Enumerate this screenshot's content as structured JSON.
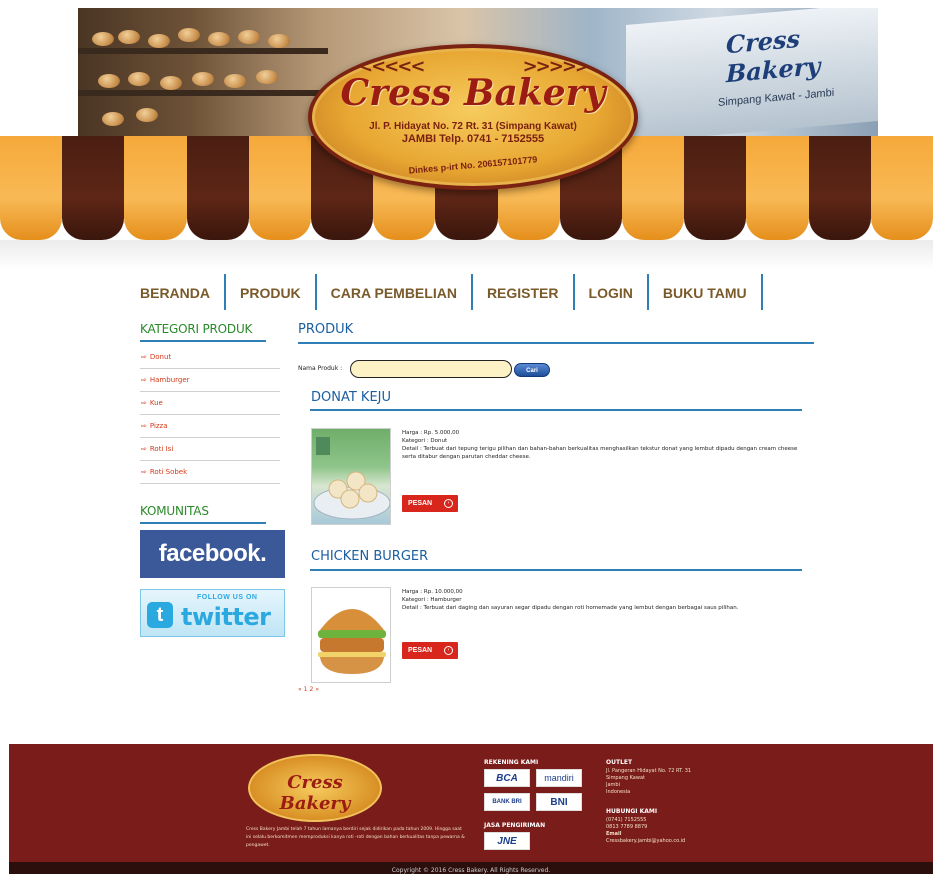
{
  "banner": {
    "logo_name": "Cress Bakery",
    "logo_address": "Jl. P. Hidayat No. 72 Rt. 31 (Simpang Kawat)",
    "logo_phone": "JAMBI Telp. 0741 - 7152555",
    "logo_dinkes": "Dinkes p-irt No. 206157101779",
    "sign_text": "Cress Bakery",
    "sign_sub": "Simpang Kawat - Jambi"
  },
  "nav": {
    "items": [
      "BERANDA",
      "PRODUK",
      "CARA PEMBELIAN",
      "REGISTER",
      "LOGIN",
      "BUKU TAMU"
    ]
  },
  "sidebar": {
    "category_title": "KATEGORI PRODUK",
    "categories": [
      "Donut",
      "Hamburger",
      "Kue",
      "Pizza",
      "Roti Isi",
      "Roti Sobek"
    ],
    "community_title": "KOMUNITAS",
    "facebook_label": "facebook.",
    "twitter_follow": "FOLLOW US ON",
    "twitter_label": "twitter"
  },
  "main": {
    "title": "PRODUK",
    "search_label": "Nama Produk :",
    "search_value": "",
    "search_button": "Cari",
    "order_button": "PESAN",
    "products": [
      {
        "name": "DONAT KEJU",
        "price": "Harga : Rp. 5.000,00",
        "category": "Kategori : Donut",
        "detail": "Detail : Terbuat dari tepung terigu pilihan dan bahan-bahan berkualitas menghasilkan tekstur donat yang lembut dipadu dengan cream cheese serta ditabur dengan parutan cheddar cheese."
      },
      {
        "name": "CHICKEN BURGER",
        "price": "Harga : Rp. 10.000,00",
        "category": "Kategori : Hamburger",
        "detail": "Detail : Terbuat dari daging dan sayuran segar dipadu dengan roti homemade yang lembut dengan berbagai saus pilihan."
      }
    ],
    "pagination": [
      "«",
      "1",
      "2",
      "»"
    ]
  },
  "footer": {
    "logo_name": "Cress Bakery",
    "about": "Cress Bakery Jambi telah 7 tahun lamanya berdiri sejak didirikan pada tahun 2009. Hingga saat ini selalu berkomitmen memproduksi kanya roti -roti dengan bahan berkualitas tanpa pewarna & pengawet.",
    "rekening_title": "REKENING KAMI",
    "banks": [
      "BCA",
      "mandiri",
      "BANK BRI",
      "BNI"
    ],
    "jasa_title": "JASA PENGIRIMAN",
    "courier": "JNE",
    "outlet_title": "OUTLET",
    "outlet_lines": [
      "Jl. Pangeran Hidayat No. 72 RT. 31",
      "Simpang Kawat",
      "Jambi",
      "Indonesia"
    ],
    "contact_title": "HUBUNGI KAMI",
    "contact_lines": [
      "(0741) 7152555",
      "0813 7789 8879",
      "Email",
      "Cressbakery.jambi@yahoo.co.id"
    ],
    "copyright": "Copyright © 2016 Cress Bakery. All Rights Reserved."
  }
}
